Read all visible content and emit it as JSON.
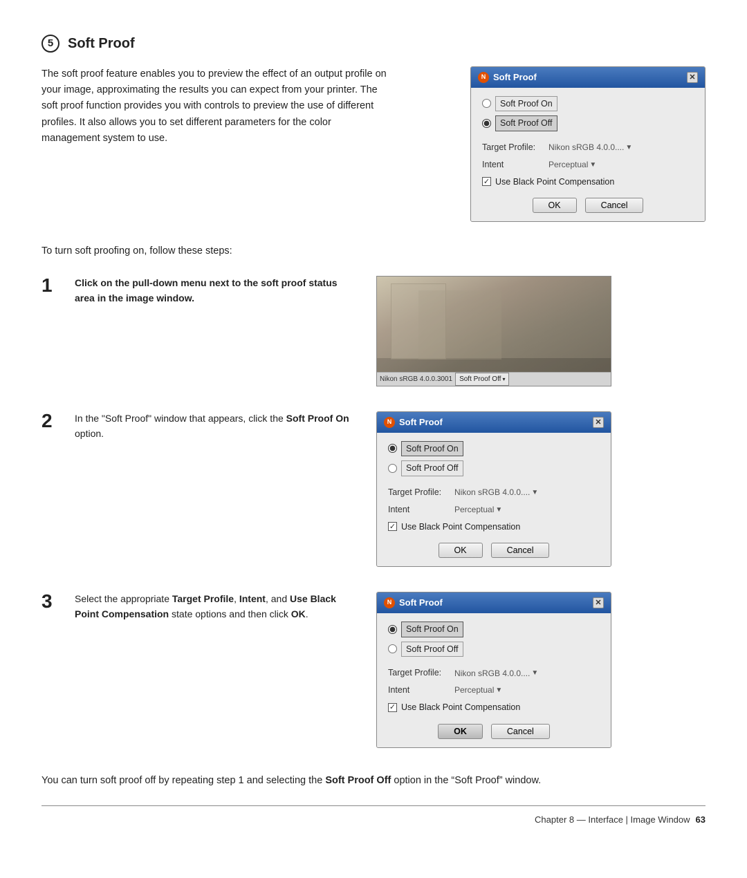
{
  "page": {
    "title": "Soft Proof",
    "section_number": "5",
    "intro": "The soft proof feature enables you to preview the effect of an output profile on your image, approximating the results you can expect from your printer. The soft proof function provides you with controls to preview the use of different profiles. It also allows you to set different parameters for the color management system to use.",
    "to_turn_text": "To turn soft proofing on, follow these steps:",
    "bottom_note_part1": "You can turn soft proof off by repeating step 1 and selecting the ",
    "bottom_note_bold": "Soft Proof Off",
    "bottom_note_part2": " option in the “Soft Proof” window.",
    "footer_text": "Chapter 8 — Interface | Image Window",
    "footer_page": "63"
  },
  "dialogs": {
    "dialog1": {
      "title": "Soft Proof",
      "radio_on": "Soft Proof On",
      "radio_off": "Soft Proof Off",
      "radio_on_selected": false,
      "radio_off_selected": true,
      "target_profile_label": "Target Profile:",
      "target_profile_value": "Nikon sRGB 4.0.0....",
      "intent_label": "Intent",
      "intent_value": "Perceptual",
      "checkbox_label": "Use Black Point Compensation",
      "checkbox_checked": true,
      "ok_label": "OK",
      "cancel_label": "Cancel"
    },
    "dialog2": {
      "title": "Soft Proof",
      "radio_on": "Soft Proof On",
      "radio_off": "Soft Proof Off",
      "radio_on_selected": true,
      "radio_off_selected": false,
      "target_profile_label": "Target Profile:",
      "target_profile_value": "Nikon sRGB 4.0.0....",
      "intent_label": "Intent",
      "intent_value": "Perceptual",
      "checkbox_label": "Use Black Point Compensation",
      "checkbox_checked": true,
      "ok_label": "OK",
      "cancel_label": "Cancel"
    },
    "dialog3": {
      "title": "Soft Proof",
      "radio_on": "Soft Proof On",
      "radio_off": "Soft Proof Off",
      "radio_on_selected": true,
      "radio_off_selected": false,
      "target_profile_label": "Target Profile:",
      "target_profile_value": "Nikon sRGB 4.0.0....",
      "intent_label": "Intent",
      "intent_value": "Perceptual",
      "checkbox_label": "Use Black Point Compensation",
      "checkbox_checked": true,
      "ok_label": "OK",
      "cancel_label": "Cancel"
    }
  },
  "steps": [
    {
      "number": "1",
      "text_bold": "Click on the pull-down menu next to the soft proof status area in the image window.",
      "text_normal": "",
      "has_image": true
    },
    {
      "number": "2",
      "text_pre": "In the “Soft Proof” window that appears, click the ",
      "text_bold": "Soft Proof On",
      "text_post": " option.",
      "has_image": true,
      "dialog_index": 1
    },
    {
      "number": "3",
      "text_pre": "Select the appropriate ",
      "text_bold1": "Target Profile",
      "text_mid1": ", ",
      "text_bold2": "Intent",
      "text_mid2": ", and ",
      "text_bold3": "Use Black Point Compensation",
      "text_post": " state options and then click ",
      "text_bold4": "OK",
      "text_end": ".",
      "has_image": true,
      "dialog_index": 2
    }
  ],
  "image_window": {
    "profile_label": "Nikon sRGB 4.0.0.3001",
    "proof_btn": "Soft Proof Off",
    "arrow": "▾"
  }
}
